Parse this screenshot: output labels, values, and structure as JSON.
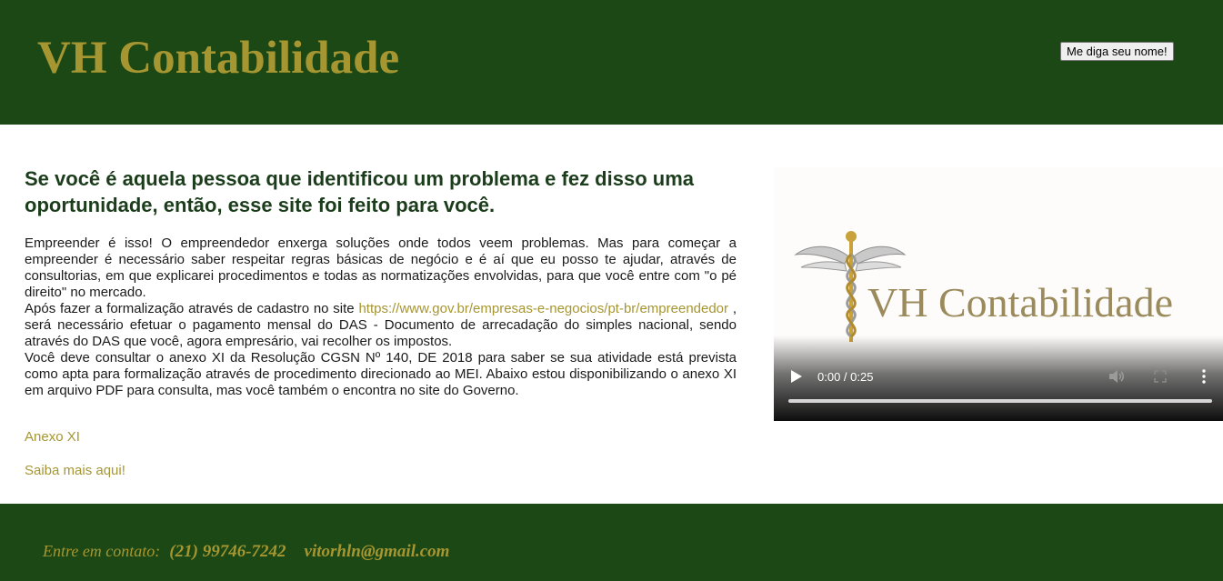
{
  "header": {
    "brand": "VH Contabilidade",
    "name_button": "Me diga seu nome!"
  },
  "main": {
    "headline": "Se você é aquela pessoa que identificou um problema e fez disso uma oportunidade, então, esse site foi feito para você.",
    "p1": "Empreender é isso! O empreendedor enxerga soluções onde todos veem problemas. Mas para começar a empreender é necessário saber respeitar regras básicas de negócio e é aí que eu posso te ajudar, através de consultorias, em que explicarei procedimentos e todas as normatizações envolvidas, para que você entre com \"o pé direito\" no mercado.",
    "p2_before": "Após fazer a formalização através de cadastro no site ",
    "p2_link": "https://www.gov.br/empresas-e-negocios/pt-br/empreendedor",
    "p2_after": " , será necessário efetuar o pagamento mensal do DAS - Documento de arrecadação do simples nacional, sendo através do DAS que você, agora empresário, vai recolher os impostos.",
    "p3": "Você deve consultar o anexo XI da Resolução CGSN Nº 140, DE 2018 para saber se sua atividade está prevista como apta para formalização através de procedimento direcionado ao MEI. Abaixo estou disponibilizando o anexo XI em arquivo PDF para consulta, mas você também o encontra no site do Governo.",
    "link_anexo": "Anexo XI",
    "link_saiba": "Saiba mais aqui!"
  },
  "video": {
    "logo_text": "VH Contabilidade",
    "time": "0:00 / 0:25",
    "progress_fraction": 0,
    "icons": [
      "caduceus-icon",
      "play-icon",
      "volume-icon",
      "fullscreen-icon",
      "more-options-icon"
    ]
  },
  "footer": {
    "contact_label": "Entre em contato:",
    "phone": "(21) 99746-7242",
    "email": "vitorhln@gmail.com"
  },
  "colors": {
    "brand_green": "#1b4814",
    "accent_gold": "#a69632",
    "headline_green": "#1b3d1b"
  }
}
